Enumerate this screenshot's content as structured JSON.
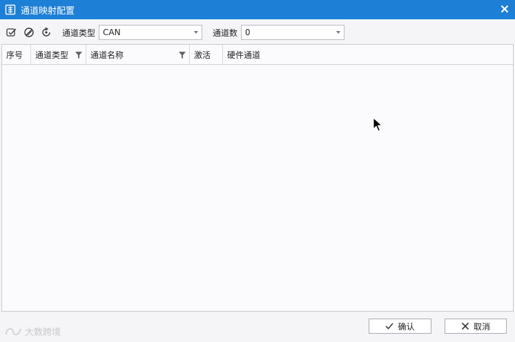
{
  "window": {
    "title": "通道映射配置"
  },
  "toolbar": {
    "icons": [
      "check-all-icon",
      "uncheck-all-icon",
      "refresh-icon"
    ],
    "channel_type_label": "通道类型",
    "channel_type_value": "CAN",
    "channel_count_label": "通道数",
    "channel_count_value": "0"
  },
  "grid": {
    "columns": [
      "序号",
      "通道类型",
      "通道名称",
      "激活",
      "硬件通道"
    ],
    "rows": []
  },
  "footer": {
    "watermark": "大数跨境",
    "ok_label": "确认",
    "cancel_label": "取消"
  },
  "colors": {
    "titlebar": "#1e7fd6",
    "background": "#f5f5f8"
  }
}
